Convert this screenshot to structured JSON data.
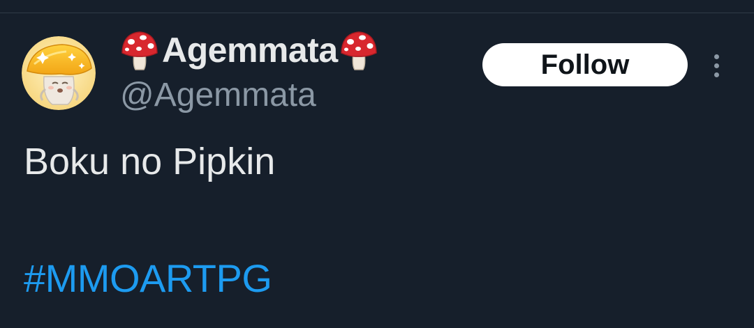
{
  "tweet": {
    "author": {
      "display_name": "Agemmata",
      "handle": "@Agemmata"
    },
    "follow_label": "Follow",
    "text": "Boku no Pipkin",
    "hashtag": "#MMOARTPG"
  },
  "colors": {
    "background": "#161f2b",
    "primary_text": "#e7e9ea",
    "secondary_text": "#8b98a5",
    "link": "#1d9bf0",
    "follow_bg": "#ffffff"
  },
  "icons": {
    "name_prefix": "mushroom-icon",
    "name_suffix": "mushroom-icon",
    "more": "more-vertical-icon"
  }
}
